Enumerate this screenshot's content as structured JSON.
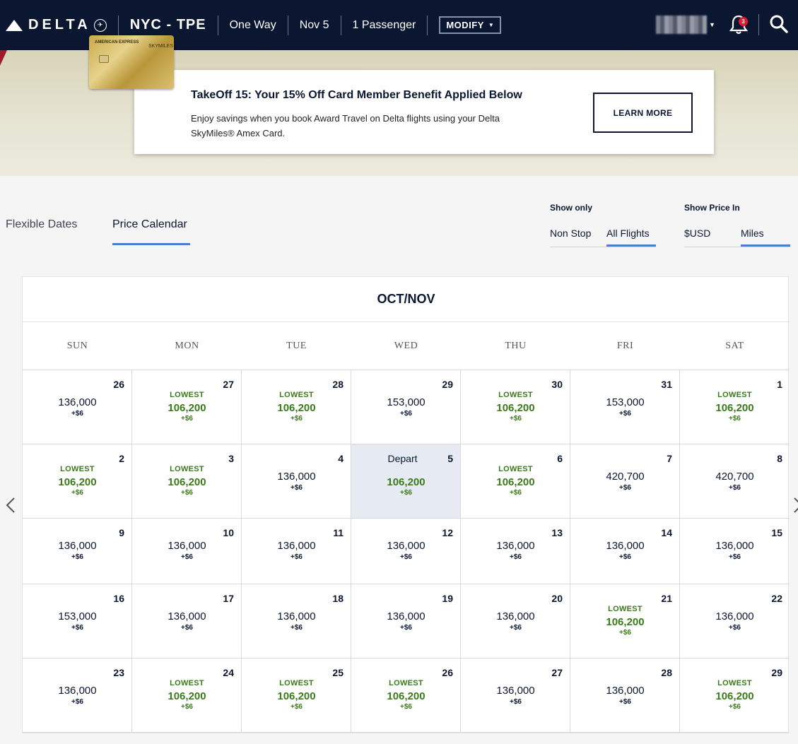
{
  "header": {
    "logo_text": "DELTA",
    "route": "NYC - TPE",
    "trip_type": "One Way",
    "date": "Nov 5",
    "passengers": "1 Passenger",
    "modify_label": "MODIFY",
    "notification_count": "3"
  },
  "banner": {
    "title": "TakeOff 15: Your 15% Off Card Member Benefit Applied Below",
    "text": "Enjoy savings when you book Award Travel on Delta flights using your Delta SkyMiles® Amex Card.",
    "button": "LEARN MORE",
    "card_brand": "AMERICAN EXPRESS",
    "card_product": "SKYMILES"
  },
  "tabs": {
    "flexible": "Flexible Dates",
    "price_calendar": "Price Calendar"
  },
  "filters": {
    "show_only_label": "Show only",
    "non_stop": "Non Stop",
    "all_flights": "All Flights",
    "show_price_label": "Show Price In",
    "usd": "$USD",
    "miles": "Miles"
  },
  "calendar": {
    "title": "OCT/NOV",
    "days_of_week": [
      "SUN",
      "MON",
      "TUE",
      "WED",
      "THU",
      "FRI",
      "SAT"
    ],
    "lowest_label": "LOWEST",
    "depart_label": "Depart",
    "weeks": [
      [
        {
          "day": "26",
          "price": "136,000",
          "tax": "+$6",
          "lowest": false
        },
        {
          "day": "27",
          "price": "106,200",
          "tax": "+$6",
          "lowest": true
        },
        {
          "day": "28",
          "price": "106,200",
          "tax": "+$6",
          "lowest": true
        },
        {
          "day": "29",
          "price": "153,000",
          "tax": "+$6",
          "lowest": false
        },
        {
          "day": "30",
          "price": "106,200",
          "tax": "+$6",
          "lowest": true
        },
        {
          "day": "31",
          "price": "153,000",
          "tax": "+$6",
          "lowest": false
        },
        {
          "day": "1",
          "price": "106,200",
          "tax": "+$6",
          "lowest": true
        }
      ],
      [
        {
          "day": "2",
          "price": "106,200",
          "tax": "+$6",
          "lowest": true
        },
        {
          "day": "3",
          "price": "106,200",
          "tax": "+$6",
          "lowest": true
        },
        {
          "day": "4",
          "price": "136,000",
          "tax": "+$6",
          "lowest": false
        },
        {
          "day": "5",
          "price": "106,200",
          "tax": "+$6",
          "lowest": true,
          "selected": true
        },
        {
          "day": "6",
          "price": "106,200",
          "tax": "+$6",
          "lowest": true
        },
        {
          "day": "7",
          "price": "420,700",
          "tax": "+$6",
          "lowest": false
        },
        {
          "day": "8",
          "price": "420,700",
          "tax": "+$6",
          "lowest": false
        }
      ],
      [
        {
          "day": "9",
          "price": "136,000",
          "tax": "+$6",
          "lowest": false
        },
        {
          "day": "10",
          "price": "136,000",
          "tax": "+$6",
          "lowest": false
        },
        {
          "day": "11",
          "price": "136,000",
          "tax": "+$6",
          "lowest": false
        },
        {
          "day": "12",
          "price": "136,000",
          "tax": "+$6",
          "lowest": false
        },
        {
          "day": "13",
          "price": "136,000",
          "tax": "+$6",
          "lowest": false
        },
        {
          "day": "14",
          "price": "136,000",
          "tax": "+$6",
          "lowest": false
        },
        {
          "day": "15",
          "price": "136,000",
          "tax": "+$6",
          "lowest": false
        }
      ],
      [
        {
          "day": "16",
          "price": "153,000",
          "tax": "+$6",
          "lowest": false
        },
        {
          "day": "17",
          "price": "136,000",
          "tax": "+$6",
          "lowest": false
        },
        {
          "day": "18",
          "price": "136,000",
          "tax": "+$6",
          "lowest": false
        },
        {
          "day": "19",
          "price": "136,000",
          "tax": "+$6",
          "lowest": false
        },
        {
          "day": "20",
          "price": "136,000",
          "tax": "+$6",
          "lowest": false
        },
        {
          "day": "21",
          "price": "106,200",
          "tax": "+$6",
          "lowest": true
        },
        {
          "day": "22",
          "price": "136,000",
          "tax": "+$6",
          "lowest": false
        }
      ],
      [
        {
          "day": "23",
          "price": "136,000",
          "tax": "+$6",
          "lowest": false
        },
        {
          "day": "24",
          "price": "106,200",
          "tax": "+$6",
          "lowest": true
        },
        {
          "day": "25",
          "price": "106,200",
          "tax": "+$6",
          "lowest": true
        },
        {
          "day": "26",
          "price": "106,200",
          "tax": "+$6",
          "lowest": true
        },
        {
          "day": "27",
          "price": "136,000",
          "tax": "+$6",
          "lowest": false
        },
        {
          "day": "28",
          "price": "136,000",
          "tax": "+$6",
          "lowest": false
        },
        {
          "day": "29",
          "price": "106,200",
          "tax": "+$6",
          "lowest": true
        }
      ]
    ]
  },
  "colors": {
    "navy": "#0b1730",
    "accent_blue": "#4a7fd0",
    "lowest_green": "#3b7a1a",
    "alert_red": "#e01933",
    "selected_bg": "#e6ebf3"
  },
  "icons": [
    "delta-triangle-icon",
    "chevron-down-icon",
    "bell-icon",
    "search-icon",
    "chevron-left-icon",
    "chevron-right-icon"
  ]
}
